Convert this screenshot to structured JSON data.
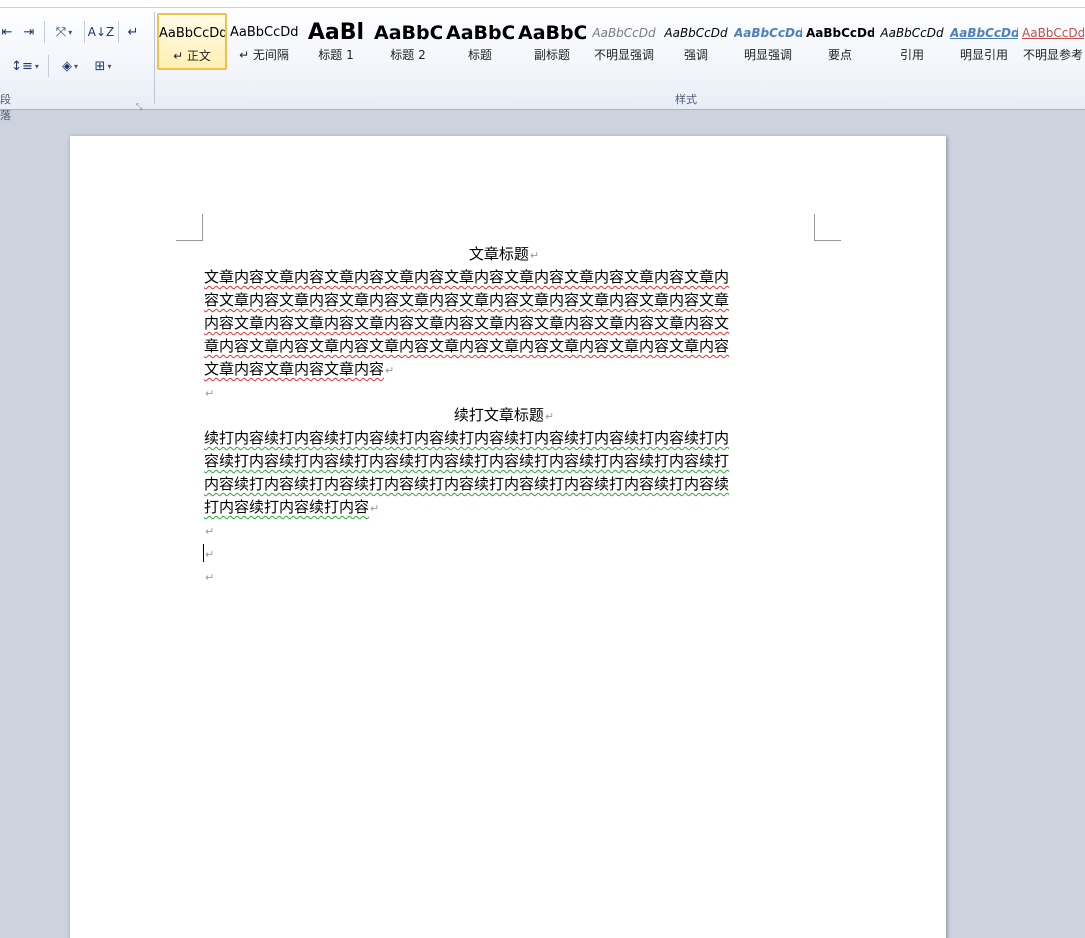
{
  "ribbon": {
    "paragraph_group_label": "段落",
    "styles_group_label": "样式",
    "styles": [
      {
        "preview": "AaBbCcDd",
        "name": "↵ 正文",
        "selected": true
      },
      {
        "preview": "AaBbCcDd",
        "name": "↵ 无间隔"
      },
      {
        "preview": "AaBl",
        "name": "标题 1"
      },
      {
        "preview": "AaBbC",
        "name": "标题 2"
      },
      {
        "preview": "AaBbC",
        "name": "标题"
      },
      {
        "preview": "AaBbC",
        "name": "副标题"
      },
      {
        "preview": "AaBbCcDd",
        "name": "不明显强调"
      },
      {
        "preview": "AaBbCcDd",
        "name": "强调"
      },
      {
        "preview": "AaBbCcDd",
        "name": "明显强调"
      },
      {
        "preview": "AaBbCcDd",
        "name": "要点"
      },
      {
        "preview": "AaBbCcDd",
        "name": "引用"
      },
      {
        "preview": "AaBbCcDd",
        "name": "明显引用"
      },
      {
        "preview": "AaBbCcDd",
        "name": "不明显参考"
      }
    ]
  },
  "document": {
    "title1": "文章标题",
    "body1": [
      "文章内容文章内容文章内容文章内容文章内容文章内容文章内容文章内容文章内",
      "容文章内容文章内容文章内容文章内容文章内容文章内容文章内容文章内容文章",
      "内容文章内容文章内容文章内容文章内容文章内容文章内容文章内容文章内容文",
      "章内容文章内容文章内容文章内容文章内容文章内容文章内容文章内容文章内容",
      "文章内容文章内容文章内容"
    ],
    "title2": "续打文章标题",
    "body2": [
      "续打内容续打内容续打内容续打内容续打内容续打内容续打内容续打内容续打内",
      "容续打内容续打内容续打内容续打内容续打内容续打内容续打内容续打内容续打",
      "内容续打内容续打内容续打内容续打内容续打内容续打内容续打内容续打内容续",
      "打内容续打内容续打内容"
    ],
    "paragraph_mark": "↵"
  }
}
